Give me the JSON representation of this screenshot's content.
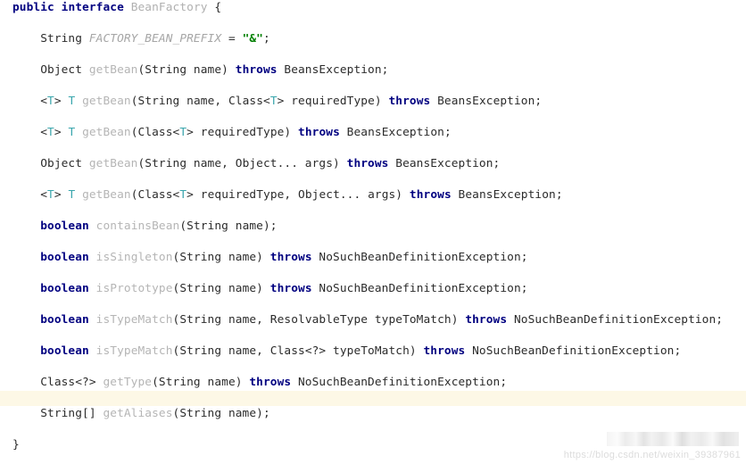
{
  "document": {
    "language": "java",
    "background_color": "#ffffff",
    "highlight_color": "#fdf8e6",
    "keyword_color": "#000080",
    "string_color": "#008000",
    "generic_color": "#3aa6ad",
    "identifier_color": "#b5b5b5",
    "text_color": "#2b2b2b"
  },
  "code": {
    "lines": [
      {
        "indent": 0,
        "highlight": false,
        "tokens": [
          {
            "t": "public",
            "c": "kw"
          },
          {
            "t": " ",
            "c": "plain"
          },
          {
            "t": "interface",
            "c": "kw"
          },
          {
            "t": " ",
            "c": "plain"
          },
          {
            "t": "BeanFactory",
            "c": "type"
          },
          {
            "t": " {",
            "c": "punc"
          }
        ]
      },
      {
        "indent": 0,
        "highlight": false,
        "tokens": []
      },
      {
        "indent": 1,
        "highlight": false,
        "tokens": [
          {
            "t": "String ",
            "c": "plain"
          },
          {
            "t": "FACTORY_BEAN_PREFIX",
            "c": "const"
          },
          {
            "t": " = ",
            "c": "plain"
          },
          {
            "t": "\"&\"",
            "c": "str"
          },
          {
            "t": ";",
            "c": "punc"
          }
        ]
      },
      {
        "indent": 0,
        "highlight": false,
        "tokens": []
      },
      {
        "indent": 1,
        "highlight": false,
        "tokens": [
          {
            "t": "Object ",
            "c": "plain"
          },
          {
            "t": "getBean",
            "c": "method"
          },
          {
            "t": "(String name) ",
            "c": "plain"
          },
          {
            "t": "throws",
            "c": "kw"
          },
          {
            "t": " BeansException;",
            "c": "plain"
          }
        ]
      },
      {
        "indent": 0,
        "highlight": false,
        "tokens": []
      },
      {
        "indent": 1,
        "highlight": false,
        "tokens": [
          {
            "t": "<",
            "c": "punc"
          },
          {
            "t": "T",
            "c": "generic"
          },
          {
            "t": "> ",
            "c": "punc"
          },
          {
            "t": "T",
            "c": "generic"
          },
          {
            "t": " ",
            "c": "plain"
          },
          {
            "t": "getBean",
            "c": "method"
          },
          {
            "t": "(String name, Class<",
            "c": "plain"
          },
          {
            "t": "T",
            "c": "generic"
          },
          {
            "t": "> requiredType) ",
            "c": "plain"
          },
          {
            "t": "throws",
            "c": "kw"
          },
          {
            "t": " BeansException;",
            "c": "plain"
          }
        ]
      },
      {
        "indent": 0,
        "highlight": false,
        "tokens": []
      },
      {
        "indent": 1,
        "highlight": false,
        "tokens": [
          {
            "t": "<",
            "c": "punc"
          },
          {
            "t": "T",
            "c": "generic"
          },
          {
            "t": "> ",
            "c": "punc"
          },
          {
            "t": "T",
            "c": "generic"
          },
          {
            "t": " ",
            "c": "plain"
          },
          {
            "t": "getBean",
            "c": "method"
          },
          {
            "t": "(Class<",
            "c": "plain"
          },
          {
            "t": "T",
            "c": "generic"
          },
          {
            "t": "> requiredType) ",
            "c": "plain"
          },
          {
            "t": "throws",
            "c": "kw"
          },
          {
            "t": " BeansException;",
            "c": "plain"
          }
        ]
      },
      {
        "indent": 0,
        "highlight": false,
        "tokens": []
      },
      {
        "indent": 1,
        "highlight": false,
        "tokens": [
          {
            "t": "Object ",
            "c": "plain"
          },
          {
            "t": "getBean",
            "c": "method"
          },
          {
            "t": "(String name, Object... args) ",
            "c": "plain"
          },
          {
            "t": "throws",
            "c": "kw"
          },
          {
            "t": " BeansException;",
            "c": "plain"
          }
        ]
      },
      {
        "indent": 0,
        "highlight": false,
        "tokens": []
      },
      {
        "indent": 1,
        "highlight": false,
        "tokens": [
          {
            "t": "<",
            "c": "punc"
          },
          {
            "t": "T",
            "c": "generic"
          },
          {
            "t": "> ",
            "c": "punc"
          },
          {
            "t": "T",
            "c": "generic"
          },
          {
            "t": " ",
            "c": "plain"
          },
          {
            "t": "getBean",
            "c": "method"
          },
          {
            "t": "(Class<",
            "c": "plain"
          },
          {
            "t": "T",
            "c": "generic"
          },
          {
            "t": "> requiredType, Object... args) ",
            "c": "plain"
          },
          {
            "t": "throws",
            "c": "kw"
          },
          {
            "t": " BeansException;",
            "c": "plain"
          }
        ]
      },
      {
        "indent": 0,
        "highlight": false,
        "tokens": []
      },
      {
        "indent": 1,
        "highlight": false,
        "tokens": [
          {
            "t": "boolean",
            "c": "kw"
          },
          {
            "t": " ",
            "c": "plain"
          },
          {
            "t": "containsBean",
            "c": "method"
          },
          {
            "t": "(String name);",
            "c": "plain"
          }
        ]
      },
      {
        "indent": 0,
        "highlight": false,
        "tokens": []
      },
      {
        "indent": 1,
        "highlight": false,
        "tokens": [
          {
            "t": "boolean",
            "c": "kw"
          },
          {
            "t": " ",
            "c": "plain"
          },
          {
            "t": "isSingleton",
            "c": "method"
          },
          {
            "t": "(String name) ",
            "c": "plain"
          },
          {
            "t": "throws",
            "c": "kw"
          },
          {
            "t": " NoSuchBeanDefinitionException;",
            "c": "plain"
          }
        ]
      },
      {
        "indent": 0,
        "highlight": false,
        "tokens": []
      },
      {
        "indent": 1,
        "highlight": false,
        "tokens": [
          {
            "t": "boolean",
            "c": "kw"
          },
          {
            "t": " ",
            "c": "plain"
          },
          {
            "t": "isPrototype",
            "c": "method"
          },
          {
            "t": "(String name) ",
            "c": "plain"
          },
          {
            "t": "throws",
            "c": "kw"
          },
          {
            "t": " NoSuchBeanDefinitionException;",
            "c": "plain"
          }
        ]
      },
      {
        "indent": 0,
        "highlight": false,
        "tokens": []
      },
      {
        "indent": 1,
        "highlight": false,
        "tokens": [
          {
            "t": "boolean",
            "c": "kw"
          },
          {
            "t": " ",
            "c": "plain"
          },
          {
            "t": "isTypeMatch",
            "c": "method"
          },
          {
            "t": "(String name, ResolvableType typeToMatch) ",
            "c": "plain"
          },
          {
            "t": "throws",
            "c": "kw"
          },
          {
            "t": " NoSuchBeanDefinitionException;",
            "c": "plain"
          }
        ]
      },
      {
        "indent": 0,
        "highlight": false,
        "tokens": []
      },
      {
        "indent": 1,
        "highlight": false,
        "tokens": [
          {
            "t": "boolean",
            "c": "kw"
          },
          {
            "t": " ",
            "c": "plain"
          },
          {
            "t": "isTypeMatch",
            "c": "method"
          },
          {
            "t": "(String name, Class<?> typeToMatch) ",
            "c": "plain"
          },
          {
            "t": "throws",
            "c": "kw"
          },
          {
            "t": " NoSuchBeanDefinitionException;",
            "c": "plain"
          }
        ]
      },
      {
        "indent": 0,
        "highlight": false,
        "tokens": []
      },
      {
        "indent": 1,
        "highlight": false,
        "tokens": [
          {
            "t": "Class<?> ",
            "c": "plain"
          },
          {
            "t": "getType",
            "c": "method"
          },
          {
            "t": "(String name) ",
            "c": "plain"
          },
          {
            "t": "throws",
            "c": "kw"
          },
          {
            "t": " NoSuchBeanDefinitionException;",
            "c": "plain"
          }
        ]
      },
      {
        "indent": 0,
        "highlight": true,
        "tokens": []
      },
      {
        "indent": 1,
        "highlight": false,
        "tokens": [
          {
            "t": "String[] ",
            "c": "plain"
          },
          {
            "t": "getAliases",
            "c": "method"
          },
          {
            "t": "(String name);",
            "c": "plain"
          }
        ]
      },
      {
        "indent": 0,
        "highlight": false,
        "tokens": []
      },
      {
        "indent": 0,
        "highlight": false,
        "tokens": [
          {
            "t": "}",
            "c": "punc"
          }
        ]
      }
    ]
  },
  "watermark": {
    "url": "https://blog.csdn.net/weixin_39387961"
  }
}
